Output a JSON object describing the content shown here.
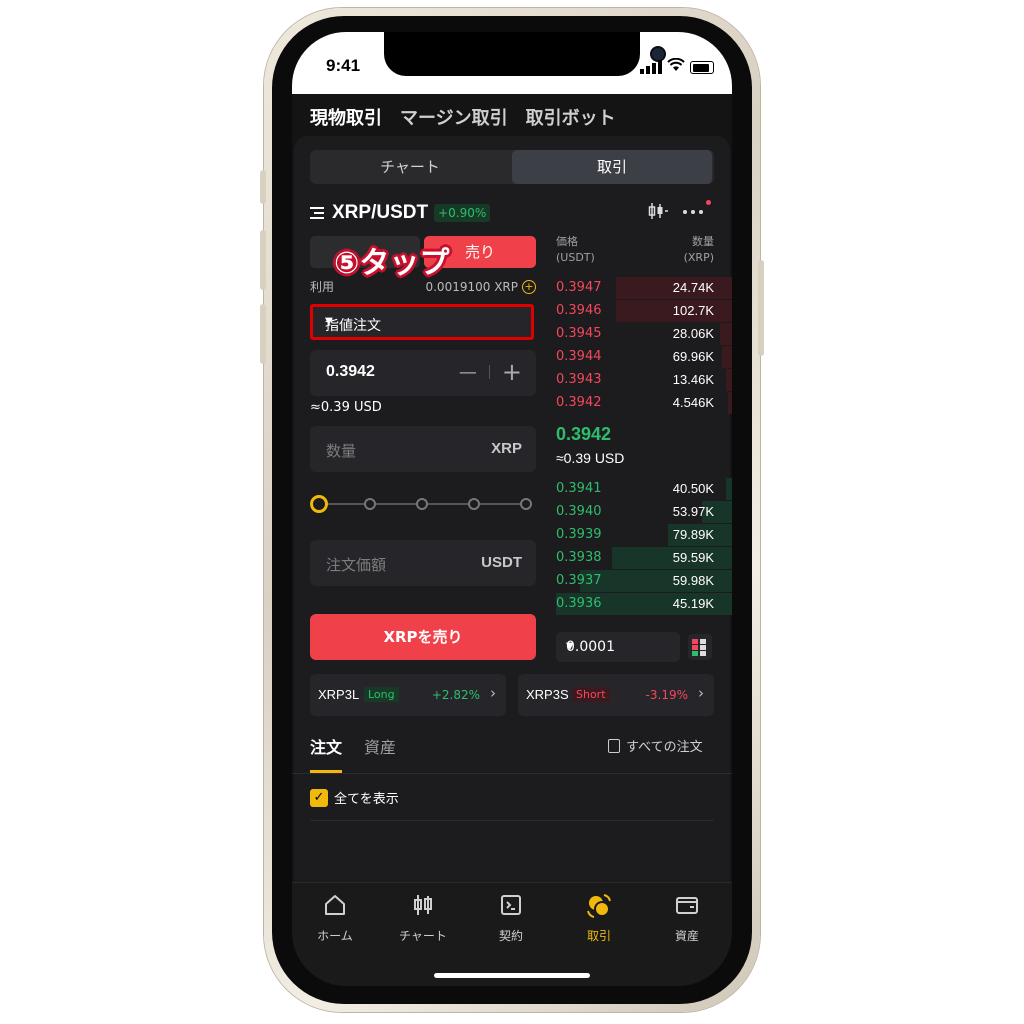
{
  "status": {
    "time": "9:41"
  },
  "top_tabs": [
    "現物取引",
    "マージン取引",
    "取引ボット"
  ],
  "segment": {
    "chart": "チャート",
    "trade": "取引"
  },
  "pair": {
    "menu_icon": "menu-lines-icon",
    "name": "XRP/USDT",
    "change": "+0.90%"
  },
  "buy_sell": {
    "sell": "売り"
  },
  "available": {
    "label": "利用",
    "value": "0.0019100 XRP"
  },
  "annotation": "⑤タップ",
  "order_type": {
    "value": "指値注文"
  },
  "price_input": {
    "value": "0.3942",
    "minus": "—",
    "plus": "+"
  },
  "price_usd": "≈0.39 USD",
  "qty_input": {
    "placeholder": "数量",
    "unit": "XRP"
  },
  "slider": {
    "value_pct": 0
  },
  "amount_input": {
    "placeholder": "注文価額",
    "unit": "USDT"
  },
  "submit": {
    "label": "XRPを売り"
  },
  "orderbook": {
    "price_header": "価格",
    "price_unit": "(USDT)",
    "qty_header": "数量",
    "qty_unit": "(XRP)",
    "asks": [
      {
        "price": "0.3947",
        "qty": "24.74K"
      },
      {
        "price": "0.3946",
        "qty": "102.7K"
      },
      {
        "price": "0.3945",
        "qty": "28.06K"
      },
      {
        "price": "0.3944",
        "qty": "69.96K"
      },
      {
        "price": "0.3943",
        "qty": "13.46K"
      },
      {
        "price": "0.3942",
        "qty": "4.546K"
      }
    ],
    "last_price": "0.3942",
    "last_usd": "≈0.39 USD",
    "bids": [
      {
        "price": "0.3941",
        "qty": "40.50K"
      },
      {
        "price": "0.3940",
        "qty": "53.97K"
      },
      {
        "price": "0.3939",
        "qty": "79.89K"
      },
      {
        "price": "0.3938",
        "qty": "59.59K"
      },
      {
        "price": "0.3937",
        "qty": "59.98K"
      },
      {
        "price": "0.3936",
        "qty": "45.19K"
      }
    ],
    "tick_size": "0.0001"
  },
  "leveraged": [
    {
      "name": "XRP3L",
      "tag": "Long",
      "change": "+2.82%"
    },
    {
      "name": "XRP3S",
      "tag": "Short",
      "change": "-3.19%"
    }
  ],
  "order_tabs": {
    "orders": "注文",
    "assets": "資産",
    "all_orders": "すべての注文"
  },
  "show_all": {
    "label": "全てを表示",
    "checked": true
  },
  "bottom_nav": [
    {
      "label": "ホーム",
      "icon": "home-icon"
    },
    {
      "label": "チャート",
      "icon": "candlestick-icon"
    },
    {
      "label": "契約",
      "icon": "contract-icon"
    },
    {
      "label": "取引",
      "icon": "trade-icon",
      "active": true
    },
    {
      "label": "資産",
      "icon": "wallet-icon"
    }
  ],
  "colors": {
    "accent": "#f0b90b",
    "sell": "#f0414b",
    "buy": "#2ebd6d",
    "highlight_box": "#e00000"
  }
}
